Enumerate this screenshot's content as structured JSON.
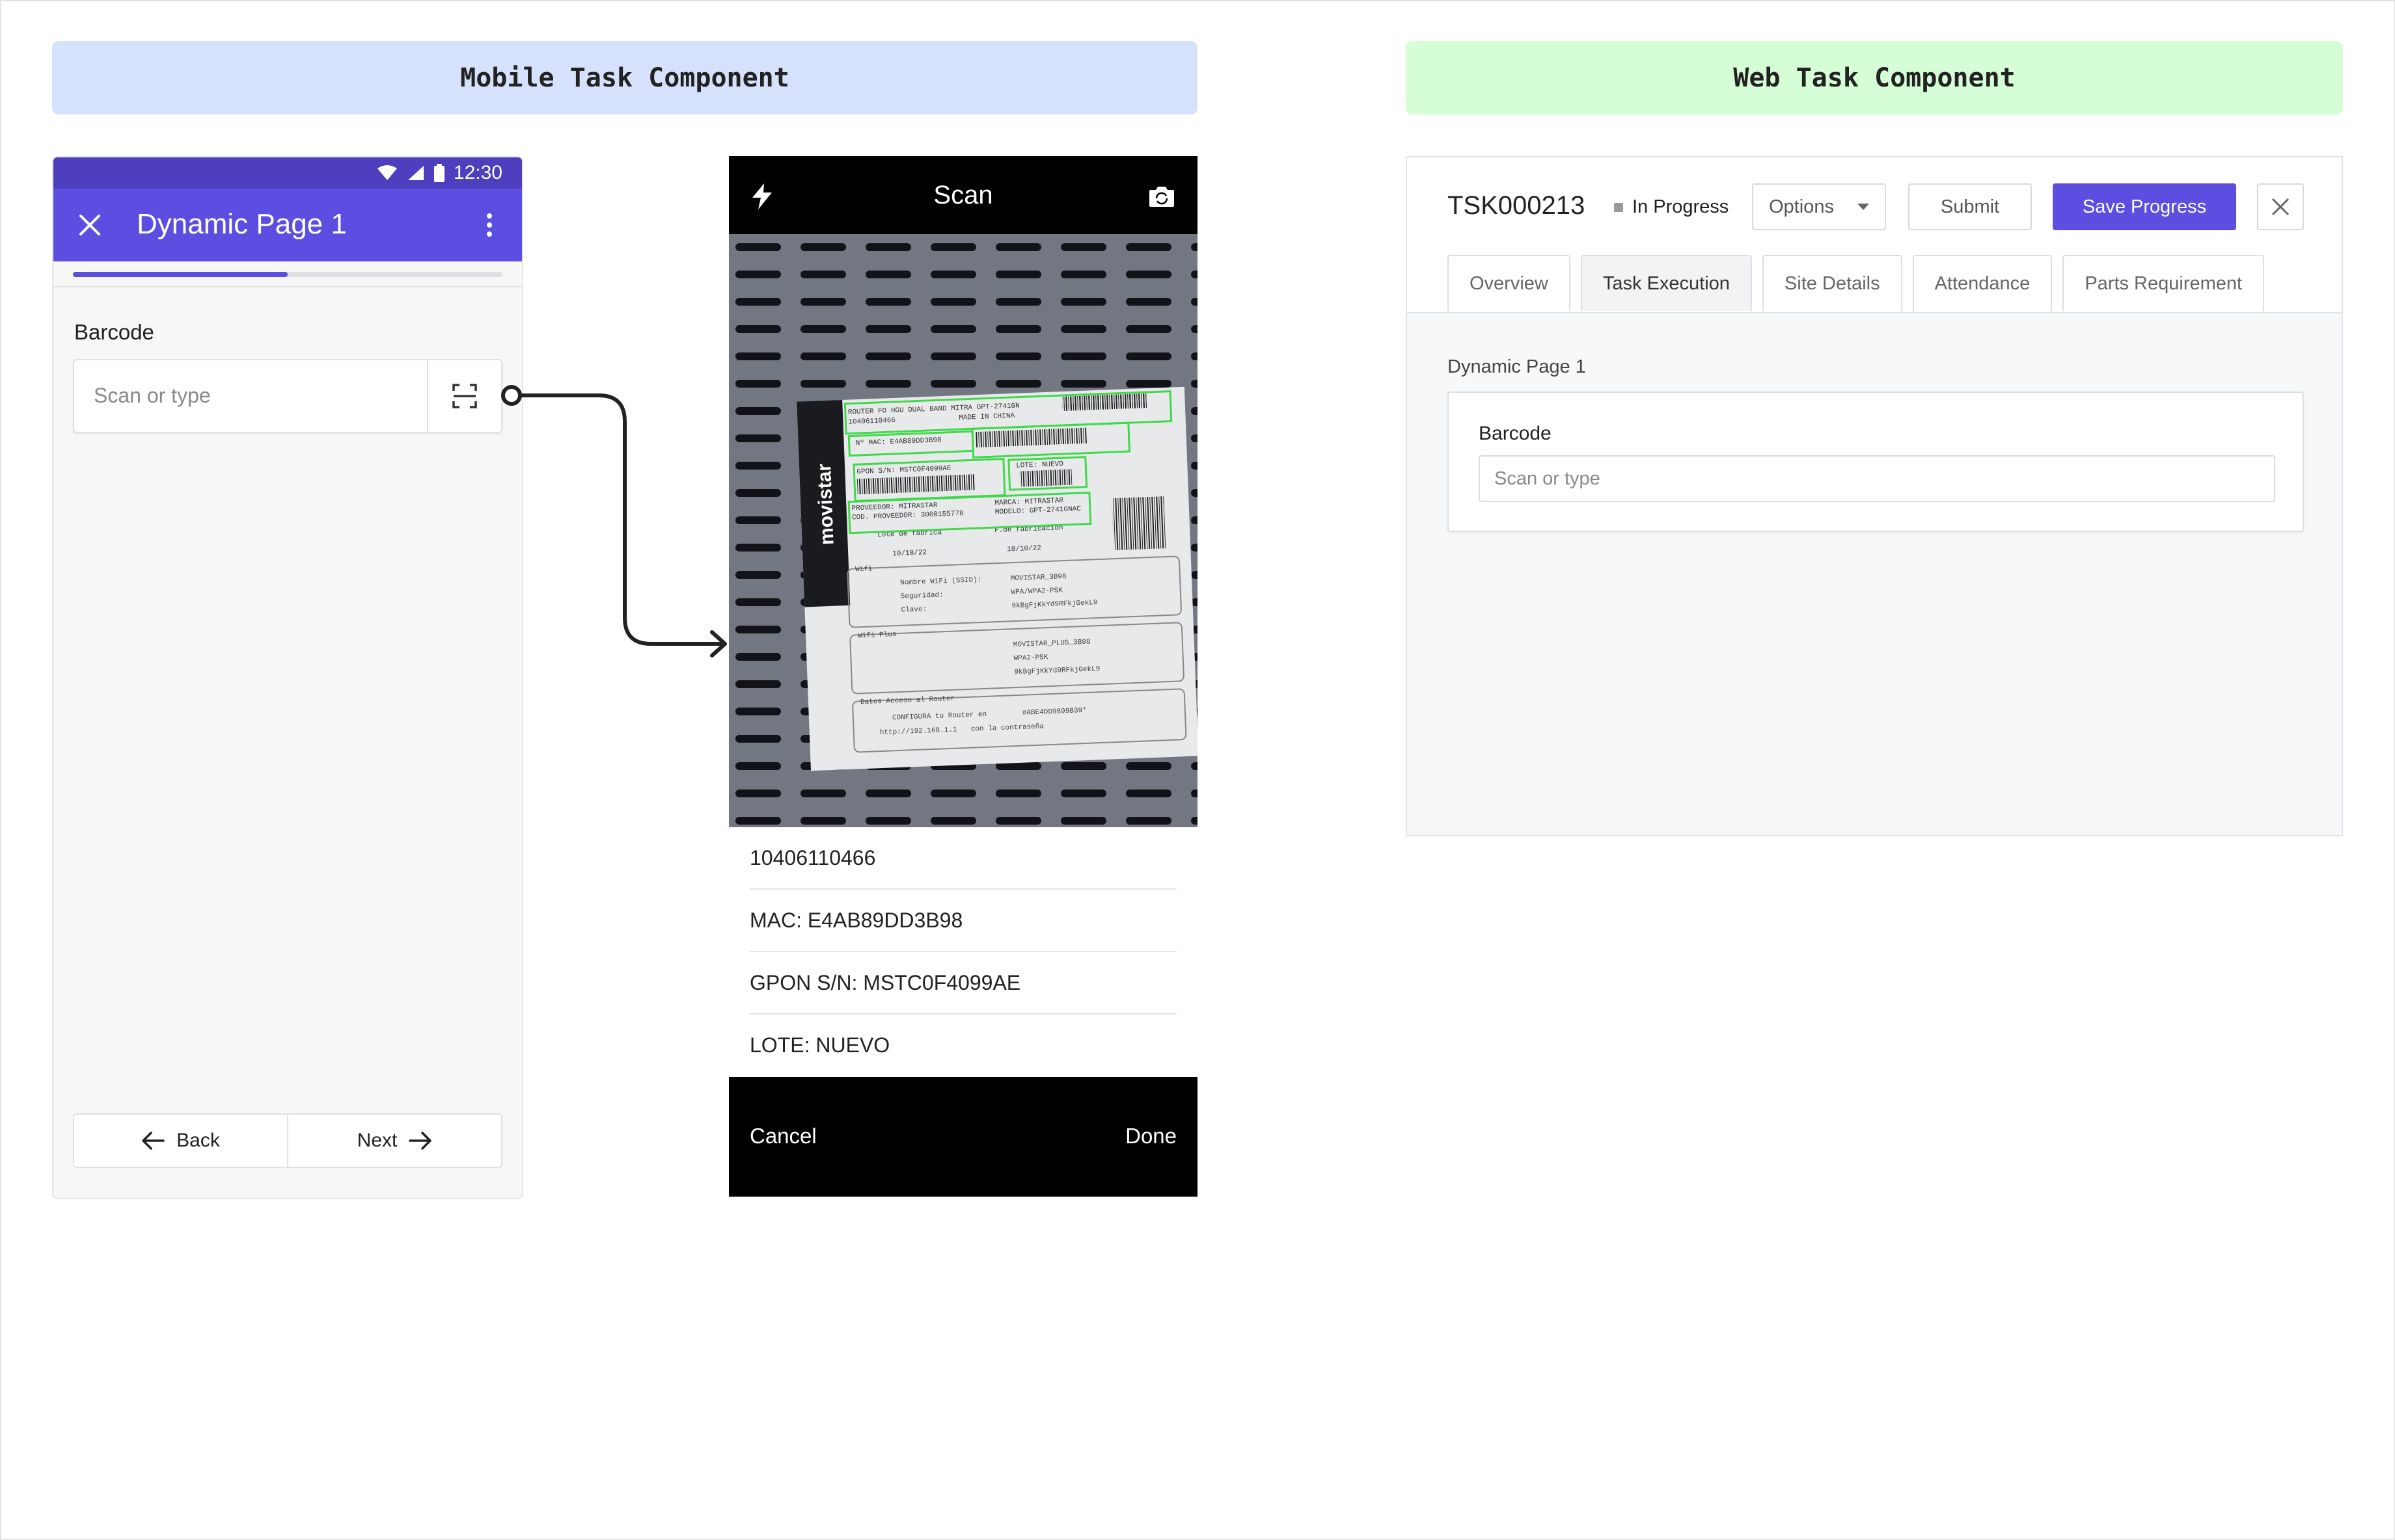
{
  "sections": {
    "mobile_title": "Mobile Task Component",
    "web_title": "Web Task Component"
  },
  "mobile": {
    "status_time": "12:30",
    "page_title": "Dynamic Page 1",
    "progress_fraction": 0.5,
    "field_label": "Barcode",
    "field_placeholder": "Scan or type",
    "back_label": "Back",
    "next_label": "Next",
    "colors": {
      "accent": "#5b4ee0",
      "statusbar": "#4d3fbd"
    }
  },
  "scanner": {
    "title": "Scan",
    "image_label_text": {
      "brand": "movistar",
      "line1": "ROUTER FO HGU DUAL BAND MITRA GPT-2741GN",
      "line2": "10406110466",
      "line3": "MADE IN CHINA",
      "mac": "Nº MAC: E4AB89DD3B98",
      "gpon": "GPON S/N: MSTC0F4099AE",
      "lote": "LOTE: NUEVO",
      "proveedor": "PROVEEDOR: MITRASTAR",
      "cod_proveedor": "COD. PROVEEDOR: 3000155778",
      "marca": "MARCA: MITRASTAR",
      "modelo": "MODELO: GPT-2741GNAC",
      "lote_fabrica": "Lote de fábrica",
      "f_fabricacion": "F.de fabricación",
      "date1": "10/10/22",
      "date2": "10/10/22",
      "wifi_header": "Wifi",
      "wifi_ssid_label": "Nombre WiFi (SSID):",
      "wifi_ssid": "MOVISTAR_3B98",
      "wifi_sec_label": "Seguridad:",
      "wifi_sec": "WPA/WPA2-PSK",
      "wifi_key_label": "Clave:",
      "wifi_key": "9kBgFjKkYd9RFkjGekL9",
      "wifiplus_header": "Wifi Plus",
      "wifiplus_ssid": "MOVISTAR_PLUS_3B98",
      "wifiplus_sec": "WPA2-PSK",
      "wifiplus_key": "9kBgFjKkYd9RFkjGekL9",
      "access_header": "Datos Acceso al Router",
      "access_line1": "CONFIGURA tu Router en",
      "access_url": "http://192.168.1.1",
      "access_line2": "con la contraseña",
      "access_pass": "#ABE4DD9899B39*"
    },
    "results": [
      "10406110466",
      "MAC: E4AB89DD3B98",
      "GPON S/N: MSTC0F4099AE",
      "LOTE: NUEVO"
    ],
    "cancel_label": "Cancel",
    "done_label": "Done",
    "colors": {
      "detection_box": "#3fd94a"
    }
  },
  "web": {
    "task_id": "TSK000213",
    "status": "In Progress",
    "options_label": "Options",
    "submit_label": "Submit",
    "save_label": "Save Progress",
    "tabs": [
      "Overview",
      "Task Execution",
      "Site Details",
      "Attendance",
      "Parts Requirement"
    ],
    "active_tab": "Task Execution",
    "page_title": "Dynamic Page 1",
    "field_label": "Barcode",
    "field_placeholder": "Scan or type",
    "colors": {
      "accent": "#5b4ee0"
    }
  }
}
